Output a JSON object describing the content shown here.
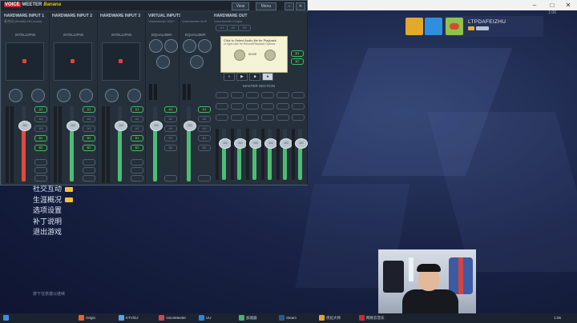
{
  "voicemeeter": {
    "brand_top": "VOICE",
    "brand_mid": "MEETER",
    "brand_sub": "Banana",
    "view_label": "View",
    "menu_label": "Menu",
    "strips": [
      {
        "title": "HARDWARE INPUT 1",
        "sub": "麦克风 (Realtek HD Audio)",
        "pan_label": "INTELLIPAN",
        "fader_db": "0.0",
        "color": "#e14a3f"
      },
      {
        "title": "HARDWARE INPUT 2",
        "sub": "",
        "pan_label": "INTELLIPAN",
        "fader_db": "0.0",
        "color": "#4dbd75"
      },
      {
        "title": "HARDWARE INPUT 3",
        "sub": "",
        "pan_label": "INTELLIPAN",
        "fader_db": "0.0",
        "color": "#4dbd75"
      },
      {
        "title": "VIRTUAL INPUTS",
        "sub": "Voicemeeter VAIO",
        "pan_label": "EQUALIZER",
        "fader_db": "0.0",
        "color": "#4dbd75"
      },
      {
        "title": "",
        "sub": "Voicemeeter AUX",
        "pan_label": "EQUALIZER",
        "fader_db": "0.0",
        "color": "#4dbd75"
      }
    ],
    "hardware_out_title": "HARDWARE OUT",
    "hardware_out_sub": "Voicemeeter Output",
    "tape_popup": {
      "line1": "Click to Select Audio file for Playback",
      "line2": "or right-click for Record/Playback Options",
      "time": "00:00"
    },
    "master_section_label": "MASTER SECTION",
    "bus_labels": [
      "A1",
      "A2",
      "A3",
      "B1",
      "B2"
    ],
    "master_faders": [
      "0.0",
      "0.0",
      "0.0",
      "0.0",
      "0.0",
      "0.0"
    ],
    "accent_red": "#c9252d",
    "accent_green": "#4dbd75"
  },
  "profile": {
    "username": "LTPDAFEIZHU"
  },
  "game_menu": {
    "items": [
      {
        "label": "社交互动",
        "has_badge": true
      },
      {
        "label": "生涯概况",
        "has_badge": true
      },
      {
        "label": "选项设置",
        "has_badge": false
      },
      {
        "label": "补丁说明",
        "has_badge": false
      },
      {
        "label": "退出游戏",
        "has_badge": false
      }
    ],
    "hint": "按下任意键以继续"
  },
  "taskbar": {
    "items": [
      "Origin",
      "KTV/DJ",
      "VoiceMeeter",
      "UU",
      "加速器",
      "Steam",
      "优化大师",
      "网易云音乐"
    ],
    "clock": "1:06"
  },
  "colors": {
    "desktop_bg": "#1a2447",
    "taskbar_bg": "#1b2330"
  }
}
